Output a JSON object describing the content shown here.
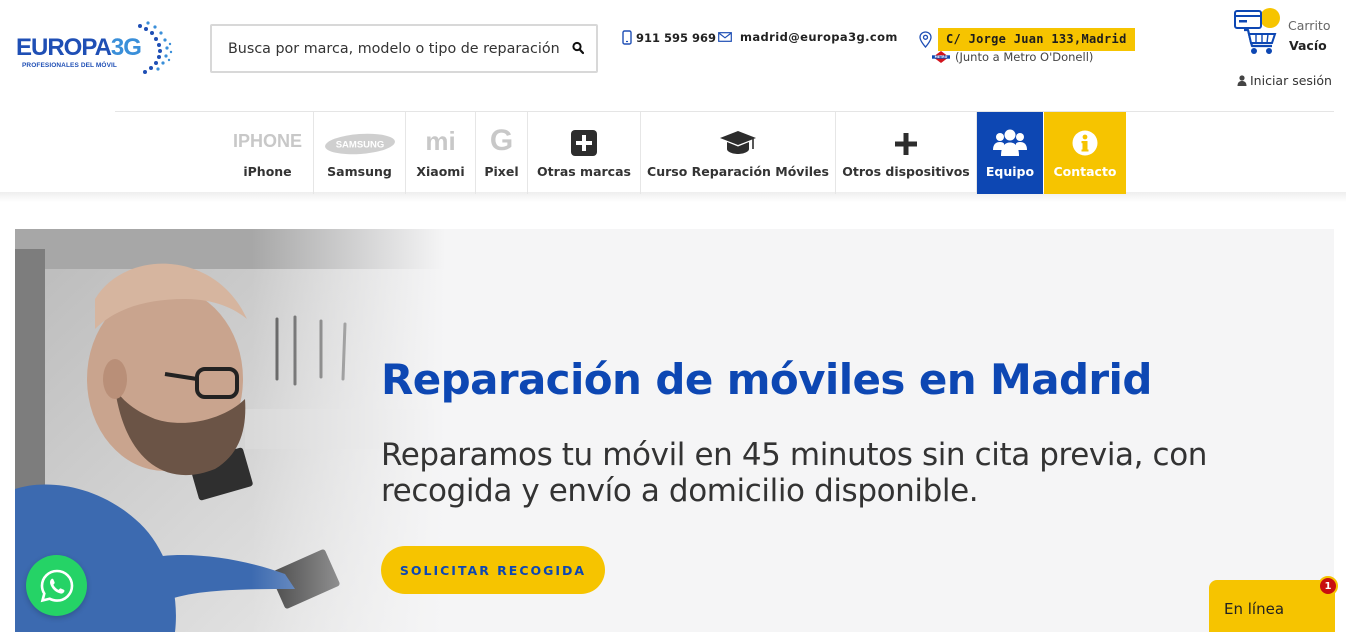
{
  "header": {
    "logo": {
      "brand_main": "EUROPA",
      "brand_accent": "3G",
      "tagline": "PROFESIONALES DEL MÓVIL"
    },
    "search": {
      "placeholder": "Busca por marca, modelo o tipo de reparación",
      "icon": "search-icon"
    },
    "phone": {
      "icon": "mobile-icon",
      "text": "911 595 969"
    },
    "email": {
      "icon": "envelope-icon",
      "text": "madrid@europa3g.com"
    },
    "address": {
      "icon": "map-pin-icon",
      "text": "C/ Jorge Juan 133,Madrid",
      "highlight_color": "#f6c400"
    },
    "metro": {
      "icon": "metro-icon",
      "text": "(Junto a Metro O'Donell)"
    },
    "cart": {
      "icon": "cart-icon",
      "label": "Carrito",
      "status": "Vacío"
    },
    "login": {
      "icon": "user-icon",
      "label": "Iniciar sesión"
    }
  },
  "nav": {
    "items": [
      {
        "label": "iPhone",
        "logo_text": "IPHONE"
      },
      {
        "label": "Samsung",
        "logo_text": "SAMSUNG"
      },
      {
        "label": "Xiaomi",
        "logo_text": "mi"
      },
      {
        "label": "Pixel",
        "logo_text": "G"
      },
      {
        "label": "Otras marcas",
        "icon": "plus-square-icon"
      },
      {
        "label": "Curso Reparación Móviles",
        "icon": "graduation-cap-icon"
      },
      {
        "label": "Otros dispositivos",
        "icon": "plus-icon"
      },
      {
        "label": "Equipo",
        "icon": "users-icon",
        "bg": "#0d47b3"
      },
      {
        "label": "Contacto",
        "icon": "info-icon",
        "bg": "#f6c400"
      }
    ]
  },
  "hero": {
    "title": "Reparación de móviles en Madrid",
    "subtitle": "Reparamos tu móvil en 45 minutos sin cita previa, con recogida y envío a domicilio disponible.",
    "button_label": "SOLICITAR RECOGIDA",
    "image": "technician-repairing-phone-photo"
  },
  "whatsapp": {
    "icon": "whatsapp-icon"
  },
  "chat": {
    "label": "En línea",
    "badge": "1"
  },
  "colors": {
    "primary_blue": "#0d47b3",
    "accent_yellow": "#f6c400",
    "whatsapp_green": "#25d366"
  }
}
